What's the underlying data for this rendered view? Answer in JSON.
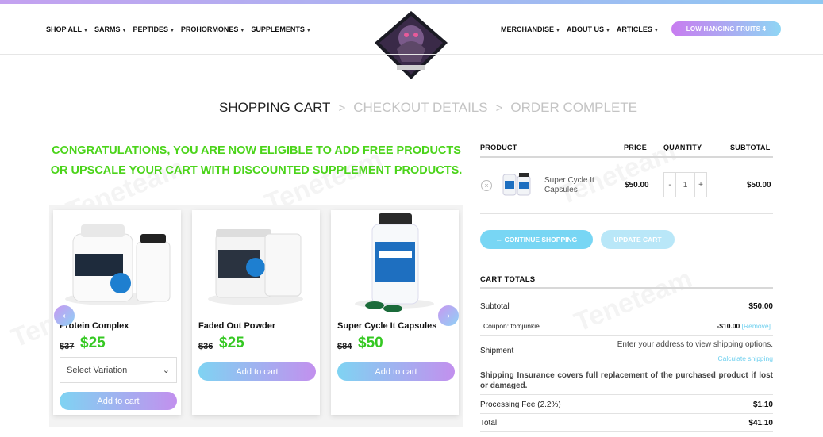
{
  "nav": {
    "left": [
      "SHOP ALL",
      "SARMS",
      "PEPTIDES",
      "PROHORMONES",
      "SUPPLEMENTS"
    ],
    "right": [
      "MERCHANDISE",
      "ABOUT US",
      "ARTICLES"
    ],
    "pill": "LOW HANGING FRUITS 4"
  },
  "steps": {
    "cart": "SHOPPING CART",
    "sep": ">",
    "checkout": "CHECKOUT DETAILS",
    "complete": "ORDER COMPLETE"
  },
  "congrats": "CONGRATULATIONS, YOU ARE NOW ELIGIBLE TO ADD FREE PRODUCTS OR UPSCALE YOUR CART WITH DISCOUNTED SUPPLEMENT PRODUCTS.",
  "products": [
    {
      "name": "Protein Complex",
      "old_price": "$37",
      "new_price": "$25",
      "select": "Select Variation",
      "button": "Add to cart"
    },
    {
      "name": "Faded Out Powder",
      "old_price": "$36",
      "new_price": "$25",
      "button": "Add to cart"
    },
    {
      "name": "Super Cycle It Capsules",
      "old_price": "$84",
      "new_price": "$50",
      "button": "Add to cart"
    }
  ],
  "cart": {
    "headers": {
      "product": "PRODUCT",
      "price": "PRICE",
      "quantity": "QUANTITY",
      "subtotal": "SUBTOTAL"
    },
    "item": {
      "name": "Super Cycle It Capsules",
      "price": "$50.00",
      "qty": "1",
      "subtotal": "$50.00"
    },
    "continue": "← CONTINUE SHOPPING",
    "update": "UPDATE CART"
  },
  "totals": {
    "title": "CART TOTALS",
    "subtotal_label": "Subtotal",
    "subtotal_value": "$50.00",
    "coupon_label": "Coupon: tomjunkie",
    "coupon_value": "-$10.00",
    "coupon_remove": "[Remove]",
    "shipment_label": "Shipment",
    "shipment_text": "Enter your address to view shipping options.",
    "shipment_link": "Calculate shipping",
    "insurance": "Shipping Insurance covers full replacement of the purchased product if lost or damaged.",
    "fee_label": "Processing Fee (2.2%)",
    "fee_value": "$1.10",
    "total_label": "Total",
    "total_value": "$41.10"
  },
  "watermark": "Teneteam",
  "colors": {
    "green": "#35c822",
    "accent": "#78d6f4",
    "purple": "#c290ee"
  }
}
